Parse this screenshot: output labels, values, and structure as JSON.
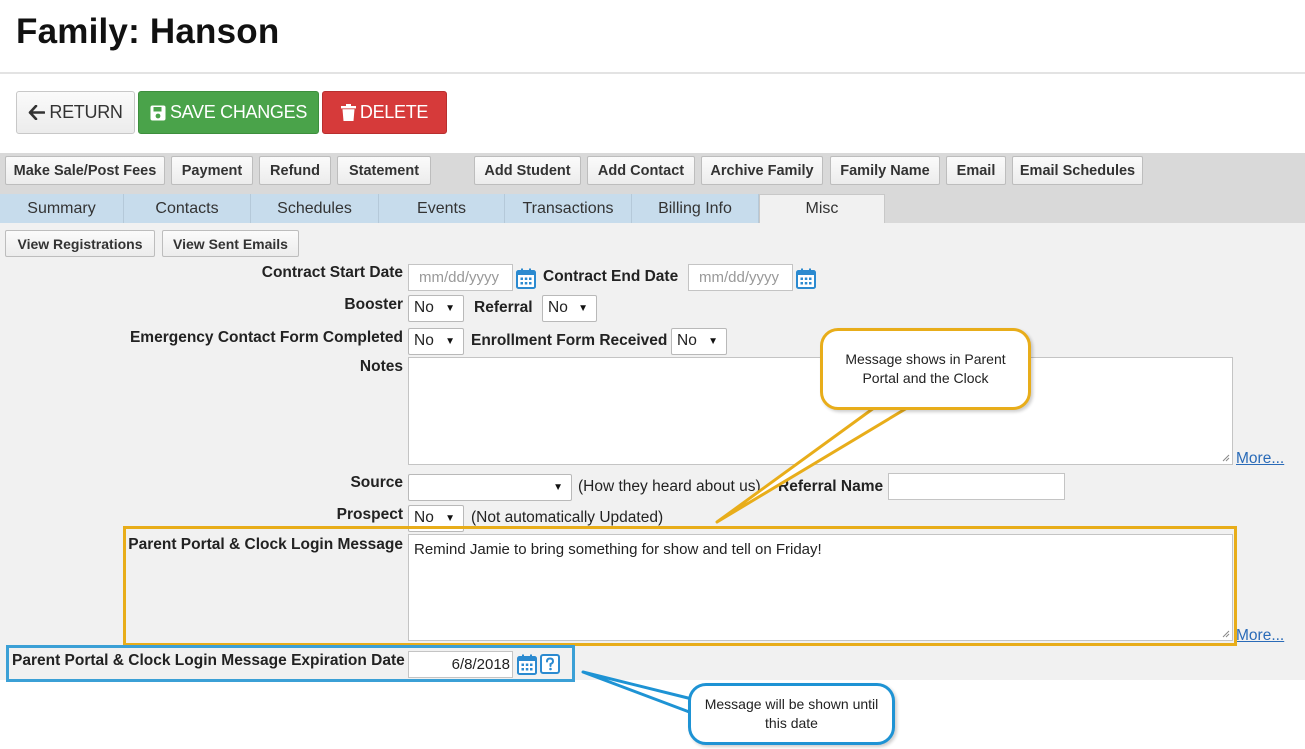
{
  "page": {
    "title": "Family: Hanson"
  },
  "actions": {
    "return_label": "RETURN",
    "save_label": "SAVE CHANGES",
    "delete_label": "DELETE"
  },
  "toolbar": {
    "buttons": [
      "Make Sale/Post Fees",
      "Payment",
      "Refund",
      "Statement",
      "Add Student",
      "Add Contact",
      "Archive Family",
      "Family Name",
      "Email",
      "Email Schedules"
    ]
  },
  "tabs": {
    "items": [
      "Summary",
      "Contacts",
      "Schedules",
      "Events",
      "Transactions",
      "Billing Info",
      "Misc"
    ],
    "active": "Misc"
  },
  "misc": {
    "view_registrations": "View Registrations",
    "view_sent_emails": "View Sent Emails"
  },
  "form": {
    "contract_start_label": "Contract Start Date",
    "contract_start_placeholder": "mm/dd/yyyy",
    "contract_end_label": "Contract End Date",
    "contract_end_placeholder": "mm/dd/yyyy",
    "booster_label": "Booster",
    "booster_value": "No",
    "referral_label": "Referral",
    "referral_value": "No",
    "emergency_label": "Emergency Contact Form Completed",
    "emergency_value": "No",
    "enrollment_label": "Enrollment Form Received",
    "enrollment_value": "No",
    "notes_label": "Notes",
    "notes_value": "",
    "more_label": "More...",
    "source_label": "Source",
    "source_value": "",
    "source_hint": "(How they heard about us)",
    "referral_name_label": "Referral Name",
    "referral_name_value": "",
    "prospect_label": "Prospect",
    "prospect_value": "No",
    "prospect_hint": "(Not automatically Updated)",
    "portal_message_label": "Parent Portal & Clock Login Message",
    "portal_message_value": "Remind Jamie to bring something for show and tell on Friday!",
    "expiration_label": "Parent Portal & Clock Login Message Expiration Date",
    "expiration_value": "6/8/2018"
  },
  "callouts": {
    "message_callout": "Message shows in Parent Portal and the Clock",
    "expiration_callout": "Message will be shown until this date"
  },
  "colors": {
    "save_green": "#4aa34a",
    "delete_red": "#d63a3a",
    "tab_blue": "#c7dcec",
    "highlight_yellow": "#e8ad1a",
    "highlight_blue": "#3ba0d6",
    "link_blue": "#2a6bb8"
  }
}
